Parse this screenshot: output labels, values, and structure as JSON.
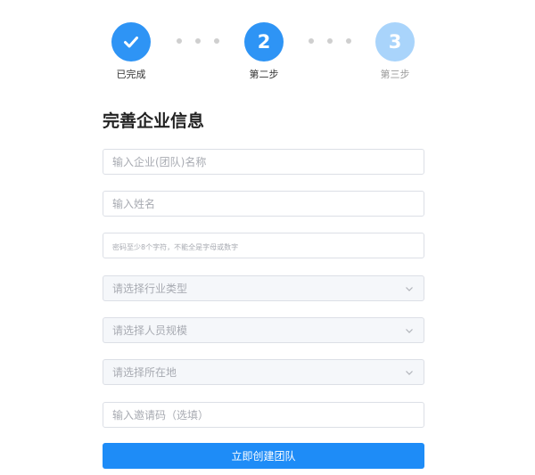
{
  "stepper": {
    "steps": [
      {
        "label": "已完成",
        "marker": "check-icon",
        "state": "done"
      },
      {
        "label": "第二步",
        "marker": "2",
        "state": "active"
      },
      {
        "label": "第三步",
        "marker": "3",
        "state": "pending"
      }
    ],
    "colors": {
      "done": "#2e94f5",
      "active": "#2e94f5",
      "pending": "#a9d4fb",
      "dots": "#cfcfcf"
    }
  },
  "form": {
    "title": "完善企业信息",
    "fields": {
      "company_name": {
        "placeholder": "输入企业(团队)名称",
        "value": ""
      },
      "full_name": {
        "placeholder": "输入姓名",
        "value": ""
      },
      "password": {
        "placeholder": "密码至少8个字符，不能全是字母或数字",
        "value": ""
      },
      "industry": {
        "placeholder": "请选择行业类型",
        "icon": "chevron-down-icon"
      },
      "staff_size": {
        "placeholder": "请选择人员规模",
        "icon": "chevron-down-icon"
      },
      "location": {
        "placeholder": "请选择所在地",
        "icon": "chevron-down-icon"
      },
      "invite_code": {
        "placeholder": "输入邀请码（选填）",
        "value": ""
      }
    },
    "submit_label": "立即创建团队"
  },
  "colors": {
    "primary": "#1e8cf7",
    "border": "#dcdfe6",
    "placeholder": "#a8abb2",
    "select_bg": "#f5f7fa"
  }
}
